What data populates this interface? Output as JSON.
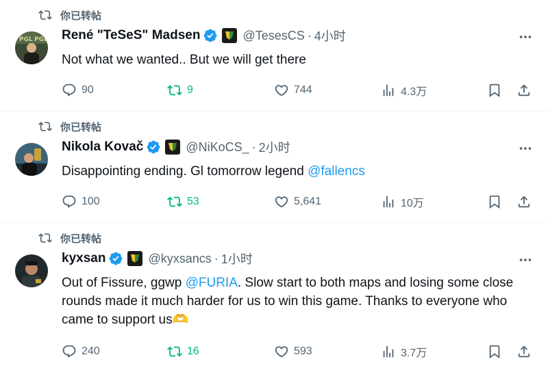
{
  "tweets": [
    {
      "retweet_label": "你已转帖",
      "name": "René \"TeSeS\" Madsen",
      "handle": "@TesesCS",
      "separator": "·",
      "time": "4小时",
      "text": "Not what we wanted.. But we will get there",
      "mention": "",
      "text_after": "",
      "replies": "90",
      "retweets": "9",
      "likes": "744",
      "views": "4.3万",
      "avatar_bg": "#2e3a2a",
      "accent": "#1d9bf0"
    },
    {
      "retweet_label": "你已转帖",
      "name": "Nikola Kovač",
      "handle": "@NiKoCS_",
      "separator": "·",
      "time": "2小时",
      "text": "Disappointing ending. Gl tomorrow legend ",
      "mention": "@fallencs",
      "text_after": "",
      "replies": "100",
      "retweets": "53",
      "likes": "5,641",
      "views": "10万",
      "avatar_bg": "#2b4b5c"
    },
    {
      "retweet_label": "你已转帖",
      "name": "kyxsan",
      "handle": "@kyxsancs",
      "separator": "·",
      "time": "1小时",
      "text": "Out of Fissure, ggwp ",
      "mention": "@FURIA",
      "text_after": ". Slow start to both maps and losing some close rounds made it much harder for us to win this game. Thanks to everyone who came to support us🫶",
      "replies": "240",
      "retweets": "16",
      "likes": "593",
      "views": "3.7万",
      "avatar_bg": "#222a2c"
    }
  ],
  "colors": {
    "text": "#0f1419",
    "muted": "#536471",
    "link": "#1d9bf0",
    "retweet_green": "#00ba7c",
    "divider": "#eff3f4"
  }
}
